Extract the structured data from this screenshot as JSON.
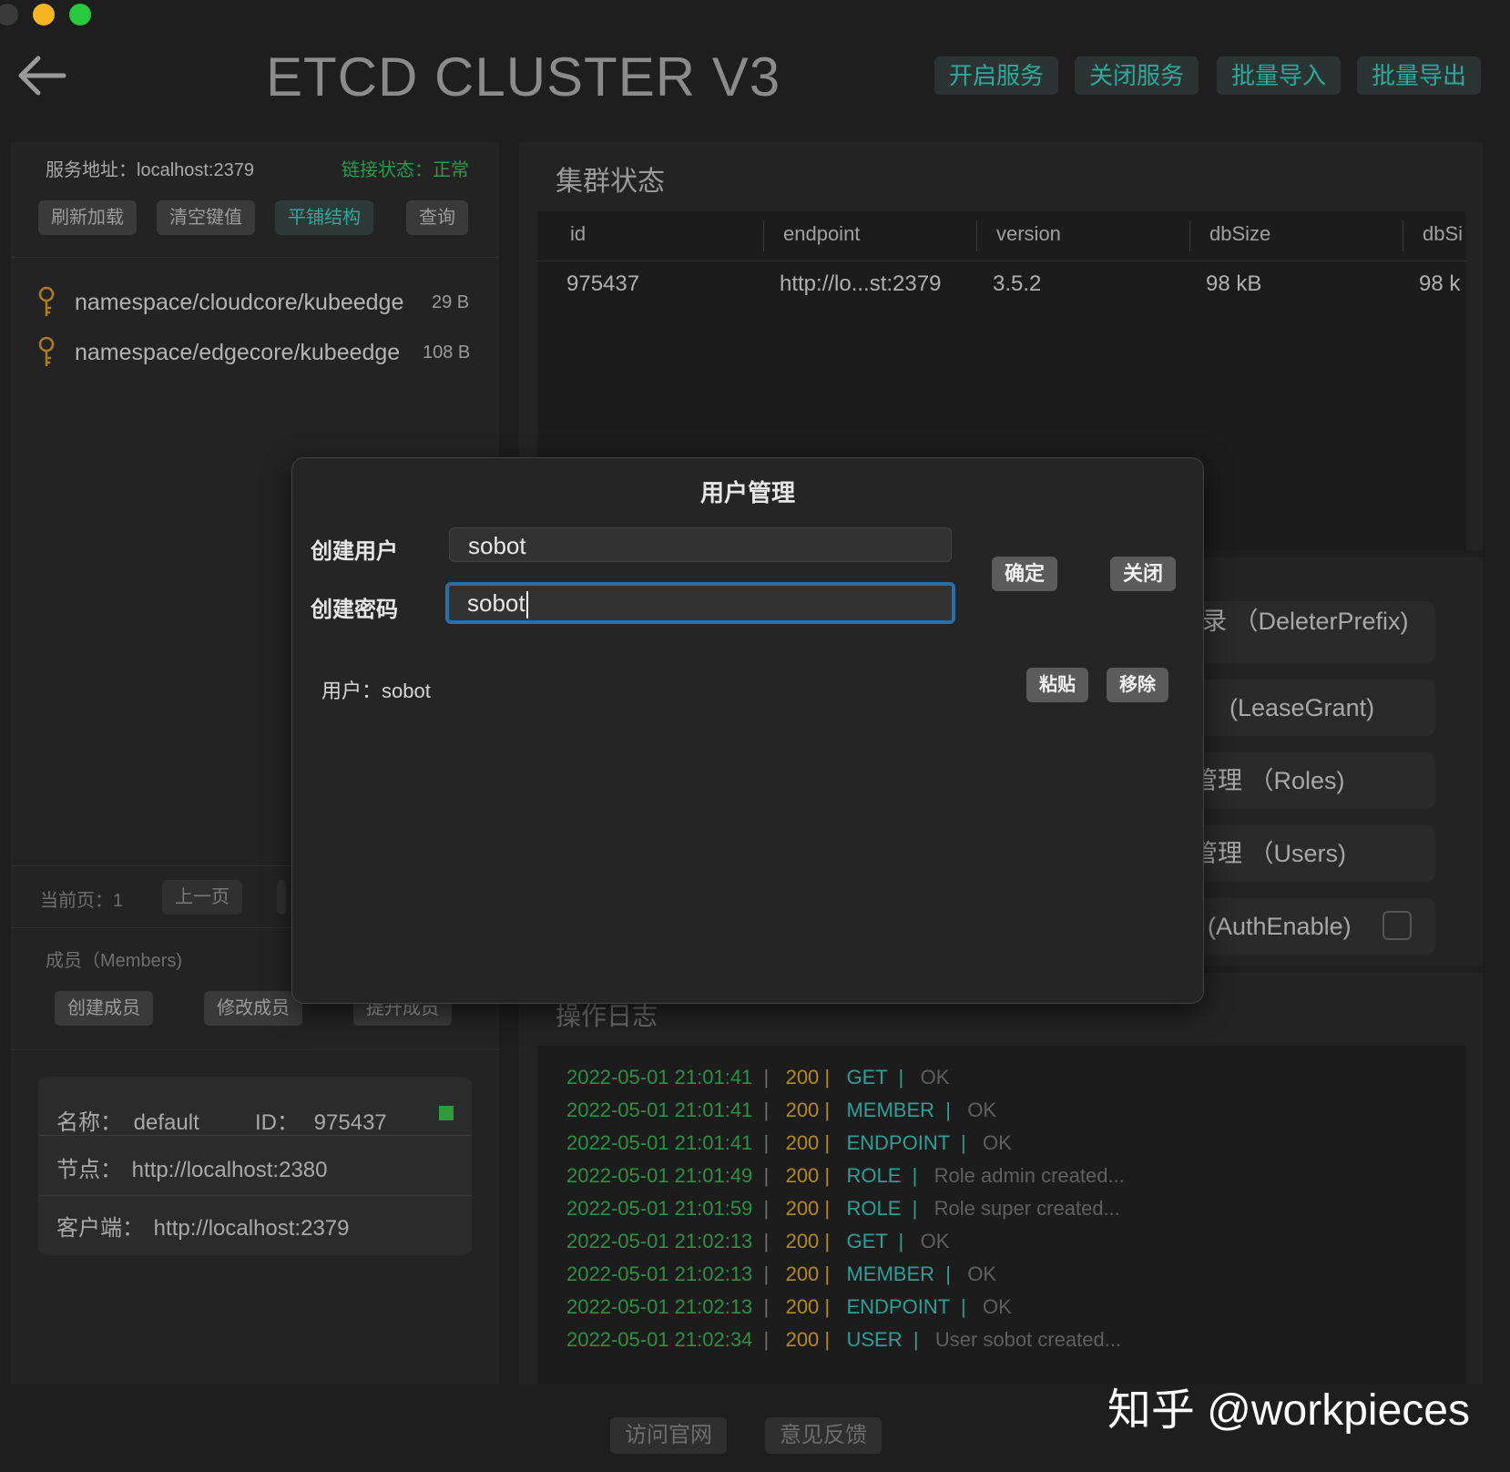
{
  "window": {
    "title": "ETCD CLUSTER V3",
    "traffic_colors": [
      "#3a3a3a",
      "#f5b524",
      "#27c93f"
    ]
  },
  "toolbar": {
    "start_service": "开启服务",
    "stop_service": "关闭服务",
    "batch_import": "批量导入",
    "batch_export": "批量导出"
  },
  "left_panel": {
    "service_address": "服务地址：localhost:2379",
    "connection_status": "链接状态：正常",
    "buttons": {
      "refresh": "刷新加载",
      "clear_keys": "清空键值",
      "flat_structure": "平铺结构",
      "query": "查询"
    },
    "keys": [
      {
        "name": "namespace/cloudcore/kubeedge",
        "size": "29 B"
      },
      {
        "name": "namespace/edgecore/kubeedge",
        "size": "108 B"
      }
    ],
    "pagination": {
      "current_page": "当前页：1",
      "prev": "上一页"
    },
    "members": {
      "title": "成员（Members)",
      "create": "创建成员",
      "modify": "修改成员",
      "promote": "提升成员"
    },
    "member_card": {
      "name_label": "名称：",
      "name_value": "default",
      "id_label": "ID：",
      "id_value": "975437",
      "node_label": "节点：",
      "node_value": "http://localhost:2380",
      "client_label": "客户端：",
      "client_value": "http://localhost:2379",
      "status_color": "#2e9a3a"
    }
  },
  "cluster_status": {
    "title": "集群状态",
    "columns": [
      "id",
      "endpoint",
      "version",
      "dbSize",
      "dbSi"
    ],
    "rows": [
      [
        "975437",
        "http://lo...st:2379",
        "3.5.2",
        "98 kB",
        "98 k"
      ]
    ]
  },
  "side_actions": {
    "partial_top": "录 （DeleterPrefix)",
    "lease": "(LeaseGrant)",
    "roles": "管理 （Roles)",
    "users": "管理 （Users)",
    "auth": "(AuthEnable)"
  },
  "operation_log": {
    "title": "操作日志",
    "entries": [
      {
        "ts": "2022-05-01 21:01:41",
        "status": "200",
        "op": "GET",
        "msg": "OK"
      },
      {
        "ts": "2022-05-01 21:01:41",
        "status": "200",
        "op": "MEMBER",
        "msg": "OK"
      },
      {
        "ts": "2022-05-01 21:01:41",
        "status": "200",
        "op": "ENDPOINT",
        "msg": "OK"
      },
      {
        "ts": "2022-05-01 21:01:49",
        "status": "200",
        "op": "ROLE",
        "msg": "Role admin created..."
      },
      {
        "ts": "2022-05-01 21:01:59",
        "status": "200",
        "op": "ROLE",
        "msg": "Role super created..."
      },
      {
        "ts": "2022-05-01 21:02:13",
        "status": "200",
        "op": "GET",
        "msg": "OK"
      },
      {
        "ts": "2022-05-01 21:02:13",
        "status": "200",
        "op": "MEMBER",
        "msg": "OK"
      },
      {
        "ts": "2022-05-01 21:02:13",
        "status": "200",
        "op": "ENDPOINT",
        "msg": "OK"
      },
      {
        "ts": "2022-05-01 21:02:34",
        "status": "200",
        "op": "USER",
        "msg": "User sobot created..."
      }
    ]
  },
  "modal": {
    "title": "用户管理",
    "username_label": "创建用户",
    "username_value": "sobot",
    "password_label": "创建密码",
    "password_value": "sobot",
    "confirm": "确定",
    "close": "关闭",
    "user_entry": "用户：sobot",
    "paste": "粘贴",
    "remove": "移除"
  },
  "footer": {
    "visit_site": "访问官网",
    "feedback": "意见反馈",
    "watermark": "知乎 @workpieces"
  },
  "colors": {
    "accent": "#2ea89c",
    "focus_ring": "#2c6ea8",
    "log_ts": "#2f8f42",
    "log_status": "#b48a1e"
  }
}
